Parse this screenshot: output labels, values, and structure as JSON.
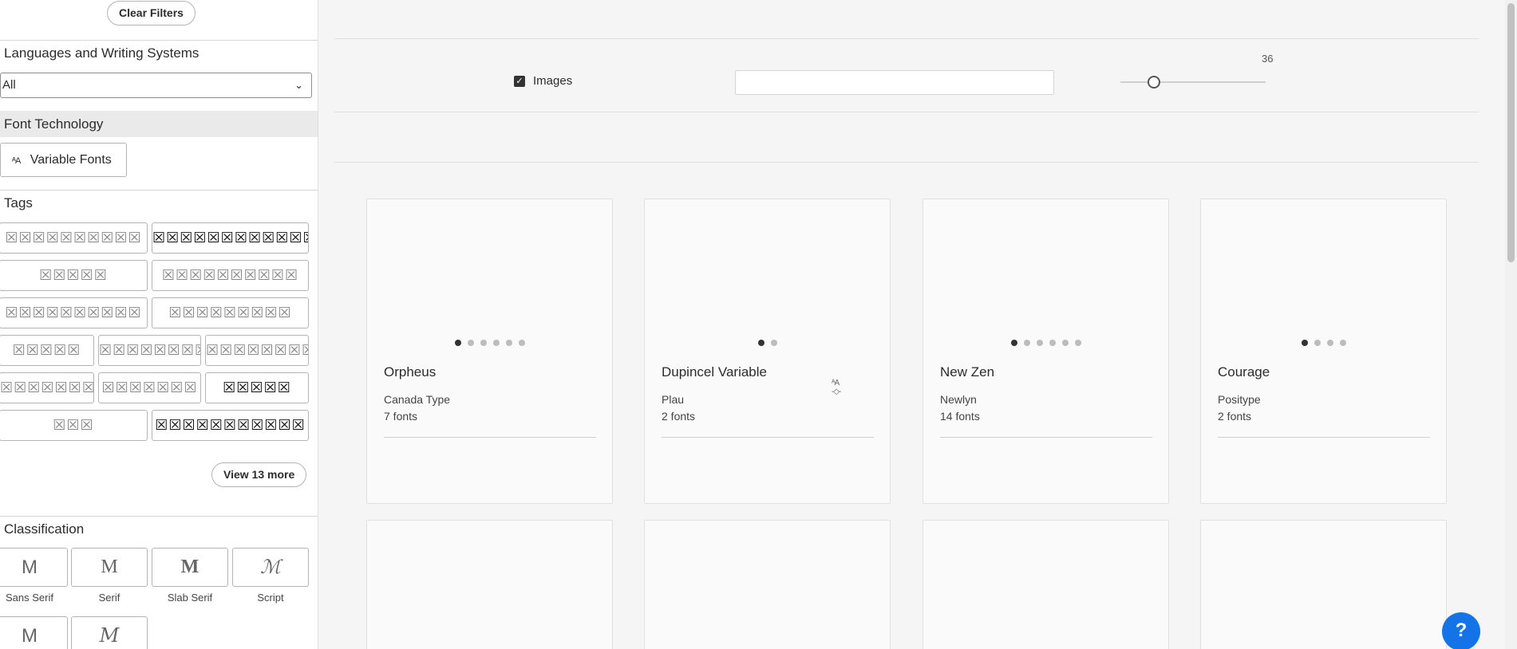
{
  "sidebar": {
    "clear_filters": "Clear Filters",
    "languages_heading": "Languages and Writing Systems",
    "language_select": "All",
    "font_technology_heading": "Font Technology",
    "variable_fonts_label": "Variable Fonts",
    "variable_fonts_icon": "variable-font-icon",
    "tags_heading": "Tags",
    "tags": [
      "☒☒☒☒☒☒☒☒☒☒",
      "☒☒☒☒☒☒☒☒☒☒☒☒☒",
      "☒☒☒☒☒",
      "☒☒☒☒☒☒☒☒☒☒",
      "☒☒☒☒☒☒☒☒☒☒",
      "☒☒☒☒☒☒☒☒☒",
      "☒☒☒☒☒",
      "☒☒☒☒☒☒☒☒",
      "☒☒☒☒☒☒☒☒",
      "☒☒☒☒☒☒☒☒☒☒",
      "☒☒☒☒☒☒☒",
      "☒☒☒☒☒",
      "☒☒☒",
      "☒☒☒☒☒☒☒☒☒☒☒"
    ],
    "view_more": "View 13 more",
    "classification_heading": "Classification",
    "classifications": [
      {
        "glyph": "M",
        "label": "Sans Serif"
      },
      {
        "glyph": "M",
        "label": "Serif"
      },
      {
        "glyph": "M",
        "label": "Slab Serif"
      },
      {
        "glyph": "ℳ",
        "label": "Script"
      },
      {
        "glyph": "M",
        "label": ""
      },
      {
        "glyph": "M",
        "label": ""
      }
    ]
  },
  "toolbar": {
    "images_label": "Images",
    "images_checked": true,
    "search_value": "",
    "size_value": "36"
  },
  "cards": [
    {
      "name": "Orpheus",
      "foundry": "Canada Type",
      "count": "7 fonts",
      "dots": 6,
      "active_dot": 1,
      "variable": false
    },
    {
      "name": "Dupincel Variable",
      "foundry": "Plau",
      "count": "2 fonts",
      "dots": 2,
      "active_dot": 1,
      "variable": true
    },
    {
      "name": "New Zen",
      "foundry": "Newlyn",
      "count": "14 fonts",
      "dots": 6,
      "active_dot": 1,
      "variable": false
    },
    {
      "name": "Courage",
      "foundry": "Positype",
      "count": "2 fonts",
      "dots": 4,
      "active_dot": 1,
      "variable": false
    }
  ],
  "help_label": "?",
  "colors": {
    "accent": "#1473e6",
    "text": "#2c2c2c",
    "border": "#b4b4b4"
  }
}
